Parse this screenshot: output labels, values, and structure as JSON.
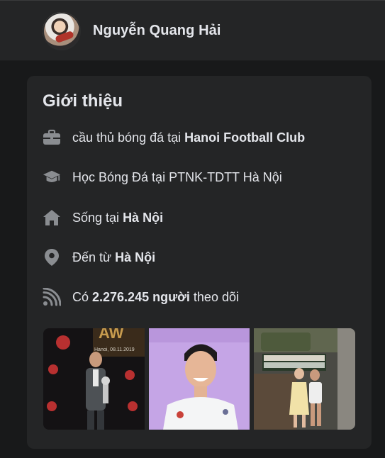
{
  "header": {
    "name": "Nguyễn Quang Hải",
    "avatar_icon": "profile-avatar"
  },
  "intro": {
    "title": "Giới thiệu",
    "rows": [
      {
        "icon": "briefcase-icon",
        "text_before": "cầu thủ bóng đá tại ",
        "bold": "Hanoi Football Club",
        "text_after": ""
      },
      {
        "icon": "graduation-cap-icon",
        "text_before": "Học Bóng Đá tại PTNK-TDTT Hà Nội",
        "bold": "",
        "text_after": ""
      },
      {
        "icon": "home-icon",
        "text_before": "Sống tại ",
        "bold": "Hà Nội",
        "text_after": ""
      },
      {
        "icon": "location-pin-icon",
        "text_before": "Đến từ ",
        "bold": "Hà Nội",
        "text_after": ""
      },
      {
        "icon": "rss-feed-icon",
        "text_before": "Có ",
        "bold": "2.276.245 người",
        "text_after": " theo dõi"
      }
    ]
  },
  "photos": {
    "caption_1": "Hanoi, 08.11.2019"
  },
  "colors": {
    "background": "#18191a",
    "card": "#242526",
    "text": "#e4e6eb",
    "icon": "#8a8d91"
  }
}
